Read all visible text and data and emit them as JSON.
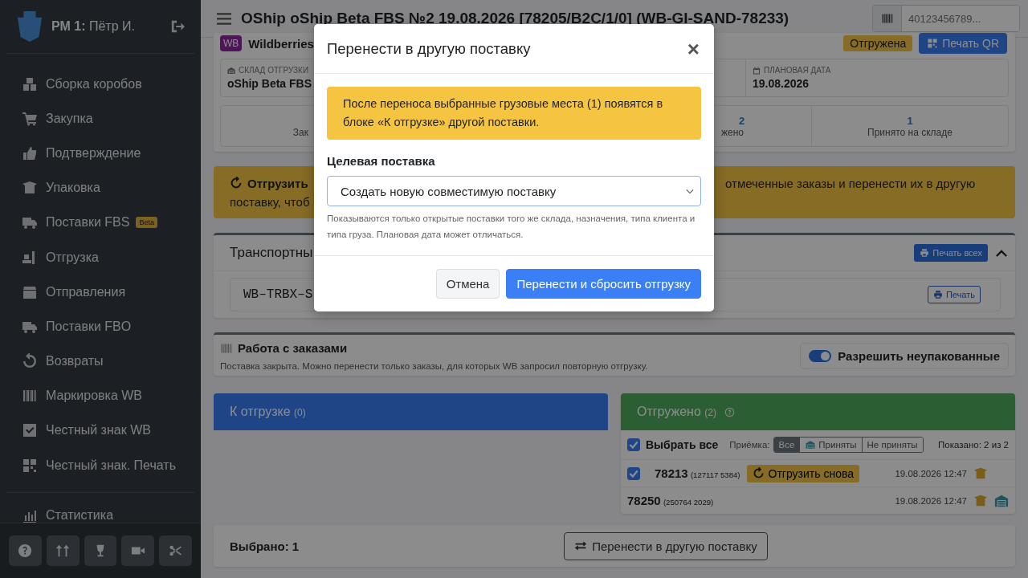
{
  "sidebar": {
    "user": "**РМ 1:** Пётр И.",
    "items": [
      {
        "label": "Сборка коробов"
      },
      {
        "label": "Закупка"
      },
      {
        "label": "Подтверждение"
      },
      {
        "label": "Упаковка"
      },
      {
        "label": "Поставки FBS",
        "badge": "Beta"
      },
      {
        "label": "Отгрузка"
      },
      {
        "label": "Отправления"
      },
      {
        "label": "Поставки FBO"
      },
      {
        "label": "Возвраты"
      },
      {
        "label": "Маркировка WB"
      },
      {
        "label": "Честный знак WB"
      },
      {
        "label": "Честный знак. Печать"
      }
    ],
    "extra_items": [
      {
        "label": "Статистика"
      }
    ]
  },
  "header": {
    "title": "OShip oShip Beta FBS №2 19.08.2026 [78205/B2C/1/0] (WB-GI-SAND-78233)",
    "scan_field": {
      "placeholder": "40123456789..."
    }
  },
  "supply": {
    "logo": "WB",
    "marketplace": "Wildberries",
    "status": "Отгружена",
    "print_qr_button": "Печать QR",
    "fields": [
      {
        "label": "СКЛАД ОТГРУЗКИ",
        "value": "oShip Beta FBS"
      },
      {
        "label": "ПЛАНОВАЯ ДАТА",
        "value": "19.08.2026"
      }
    ],
    "stats": [
      {
        "label": "Зак"
      },
      {
        "value": "2",
        "label": "жено"
      },
      {
        "value": "1",
        "label": "Принято на складе"
      }
    ]
  },
  "alert": {
    "action": "Отгрузить",
    "line_2": "поставку, чтоб",
    "right_text": "отмеченные заказы и перенести их в другую"
  },
  "transport": {
    "title": "Транспортны",
    "print_all_button": "Печать всех",
    "expanded": true,
    "boxes": [
      {
        "code": "WB–TRBX–S",
        "print_button": "Печать"
      }
    ]
  },
  "orders": {
    "title": "Работа с заказами",
    "note": "Поставка закрыта. Можно перенести только заказы, для которых WB запросил повторную отгрузку.",
    "allow_unpacked": {
      "label": "Разрешить неупакованные",
      "on": true
    }
  },
  "to_ship": {
    "title": "К отгрузке",
    "count": "(0)"
  },
  "shipped": {
    "title": "Отгружено",
    "count": "(2)",
    "select_all": {
      "label": "Выбрать все",
      "checked": true
    },
    "acceptance_label": "Приёмка:",
    "filters": [
      {
        "label": "Все",
        "selected": true
      },
      {
        "label": "Приняты",
        "selected": false
      },
      {
        "label": "Не приняты",
        "selected": false
      }
    ],
    "shown": "Показано: 2 из 2",
    "rows": [
      {
        "number": "78213",
        "code": "(127117 5384)",
        "checked": true,
        "reship_button": "Отгрузить снова",
        "date": "19.08.2026 12:47",
        "accepted": false
      },
      {
        "number": "78250",
        "code": "(250764 2029)",
        "date": "19.08.2026 12:47",
        "accepted": true
      }
    ]
  },
  "bottom_bar": {
    "selected": "Выбрано: 1",
    "move_button": "Перенести в другую поставку"
  },
  "modal": {
    "title": "Перенести в другую поставку",
    "close": "×",
    "warning": "После переноса выбранные грузовые места (1) появятся в блоке «К отгрузке» другой поставки.",
    "target_label": "Целевая поставка",
    "target_select": {
      "value": "Создать новую совместимую поставку"
    },
    "hint": "Показываются только открытые поставки того же склада, назначения, типа клиента и типа груза. Плановая дата может отличаться.",
    "buttons": [
      {
        "label": "Отмена",
        "kind": "secondary"
      },
      {
        "label": "Перенести и сбросить отгрузку",
        "kind": "primary"
      }
    ]
  }
}
